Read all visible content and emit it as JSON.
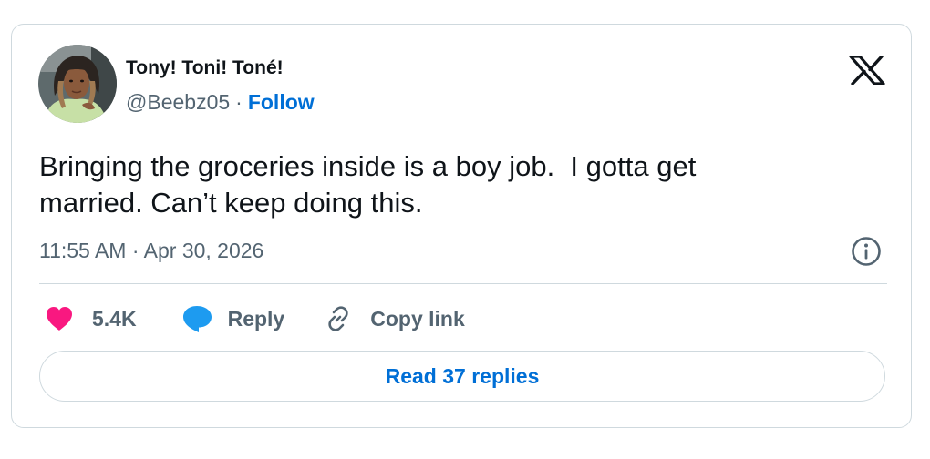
{
  "author": {
    "display_name": "Tony! Toni! Toné!",
    "handle": "@Beebz05",
    "separator": "·",
    "follow_label": "Follow"
  },
  "tweet": {
    "text_lines": [
      "Bringing the groceries inside is a boy job.  I gotta get",
      "married. Can’t keep doing this."
    ],
    "timestamp": "11:55 AM · Apr 30, 2026"
  },
  "actions": {
    "likes_count": "5.4K",
    "reply_label": "Reply",
    "copy_link_label": "Copy link"
  },
  "read_replies_label": "Read 37 replies",
  "icons": {
    "brand": "x-logo-icon",
    "info": "info-icon",
    "like": "heart-icon",
    "reply": "speech-bubble-icon",
    "copy": "link-icon"
  },
  "colors": {
    "text": "#0f1419",
    "secondary_text": "#536471",
    "link": "#006fd6",
    "heart": "#f91880",
    "reply_bubble": "#1d9bf0",
    "border": "#cfd9de"
  }
}
